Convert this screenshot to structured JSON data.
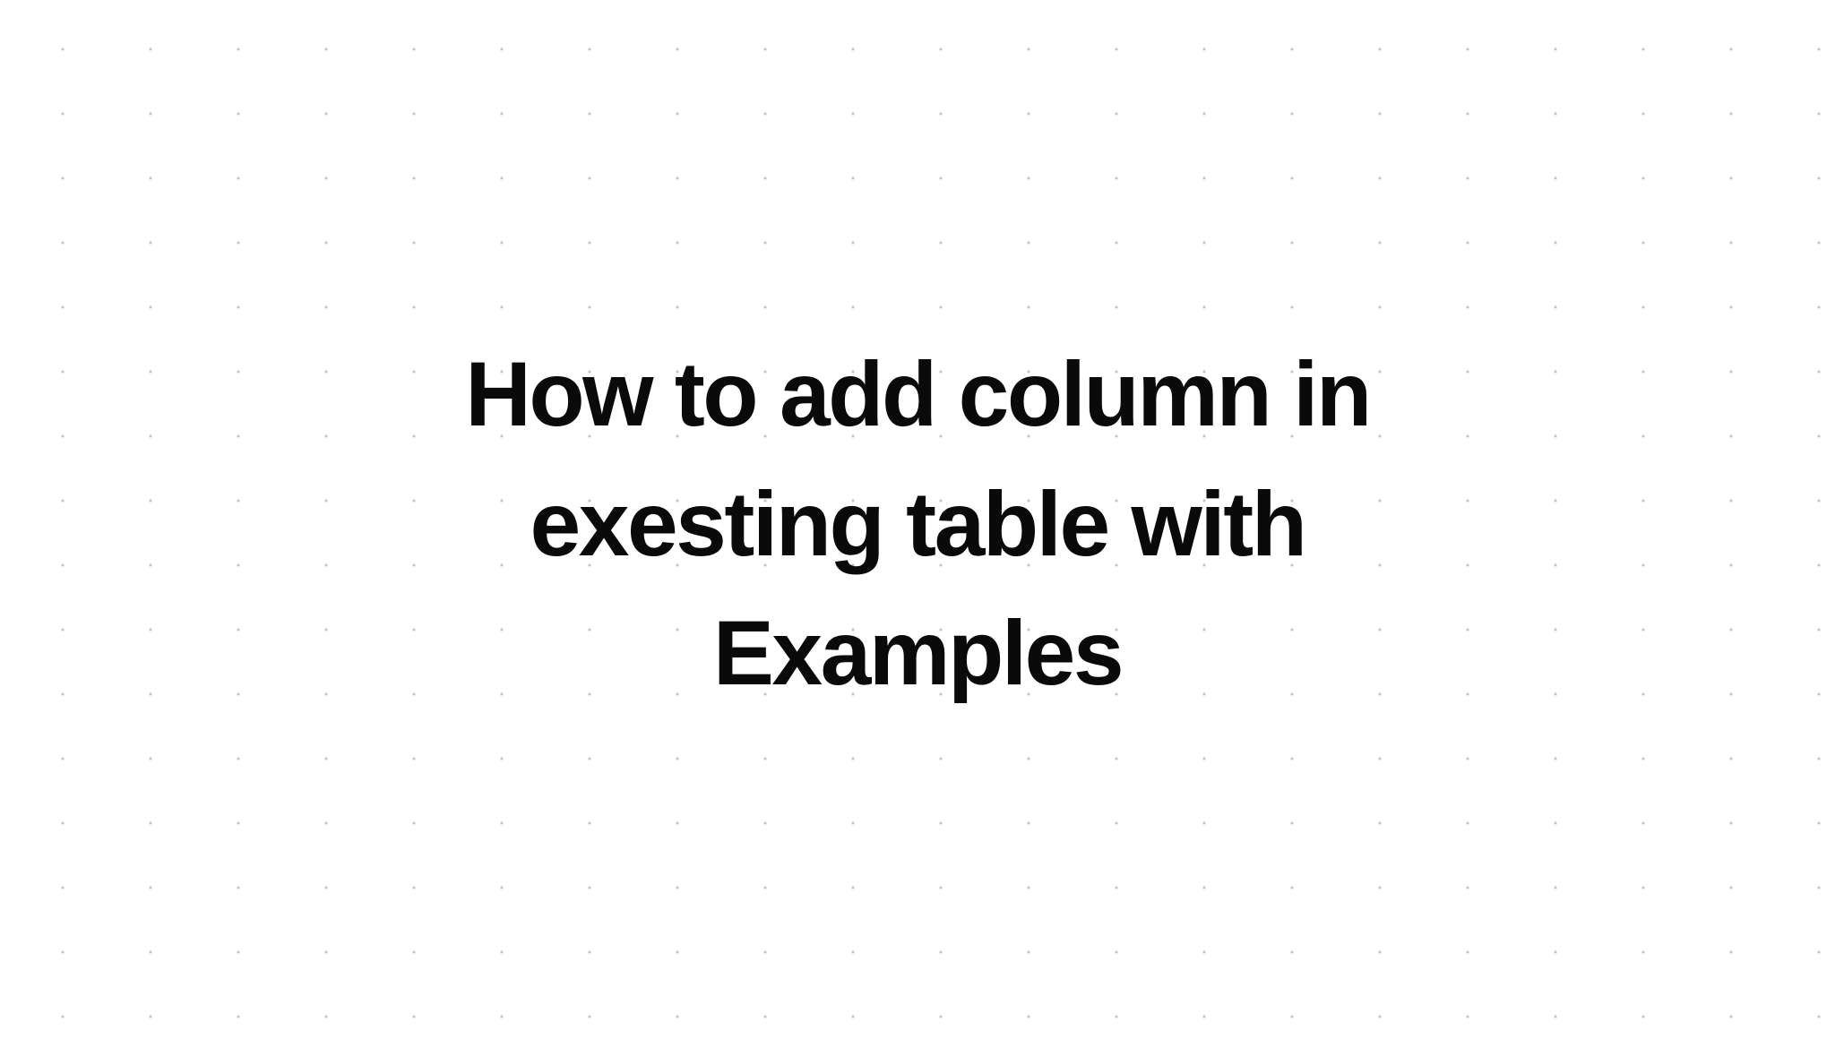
{
  "heading": {
    "text": "How to add column in exesting table with Examples"
  }
}
